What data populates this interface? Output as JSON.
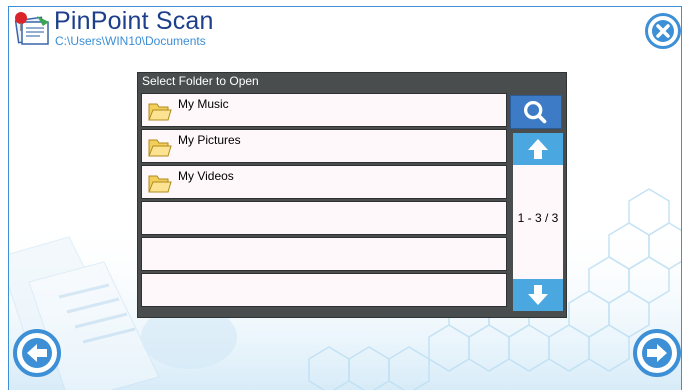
{
  "app": {
    "title": "PinPoint Scan",
    "path": "C:\\Users\\WIN10\\Documents"
  },
  "dialog": {
    "title": "Select Folder to Open",
    "folders": [
      {
        "label": "My Music"
      },
      {
        "label": "My Pictures"
      },
      {
        "label": "My Videos"
      },
      {
        "label": ""
      },
      {
        "label": ""
      },
      {
        "label": ""
      }
    ],
    "page_indicator": "1 - 3 / 3"
  },
  "icons": {
    "close": "close-icon",
    "search": "search-icon",
    "up": "arrow-up-icon",
    "down": "arrow-down-icon",
    "back": "arrow-left-icon",
    "next": "arrow-right-icon",
    "folder": "folder-icon"
  },
  "colors": {
    "accent": "#3d8fd6",
    "title": "#1d3e8a",
    "dialog_bg": "#494d4d",
    "scroll_button": "#4aa7e0",
    "search_button": "#3d7bc6"
  }
}
